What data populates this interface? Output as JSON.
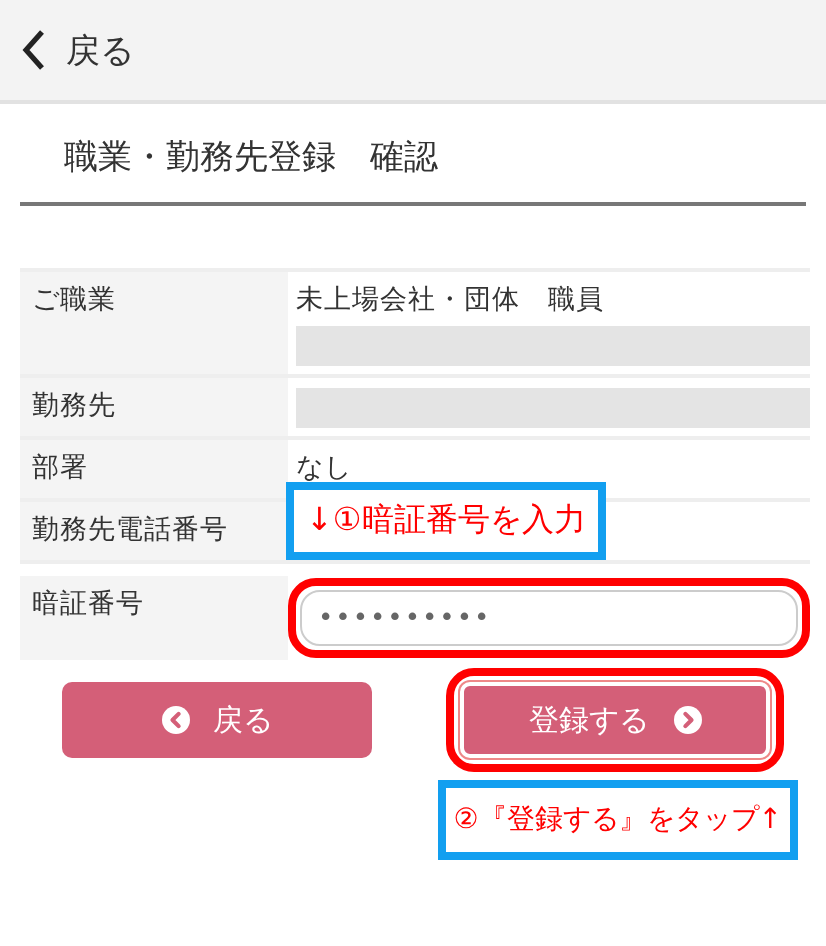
{
  "header": {
    "back_label": "戻る"
  },
  "title": "職業・勤務先登録　確認",
  "fields": [
    {
      "label": "ご職業",
      "value": "未上場会社・団体　職員",
      "redacted": true
    },
    {
      "label": "勤務先",
      "redacted": true
    },
    {
      "label": "部署",
      "value": "なし",
      "redacted": false
    },
    {
      "label": "勤務先電話番号",
      "redacted": false,
      "annotation": "↓①暗証番号を入力"
    }
  ],
  "pin": {
    "label": "暗証番号",
    "value": "••••••••••",
    "highlighted": true
  },
  "buttons": [
    {
      "kind": "back",
      "label": "戻る",
      "highlighted": false
    },
    {
      "kind": "next",
      "label": "登録する",
      "highlighted": true
    }
  ],
  "note": "②『登録する』をタップ↑"
}
